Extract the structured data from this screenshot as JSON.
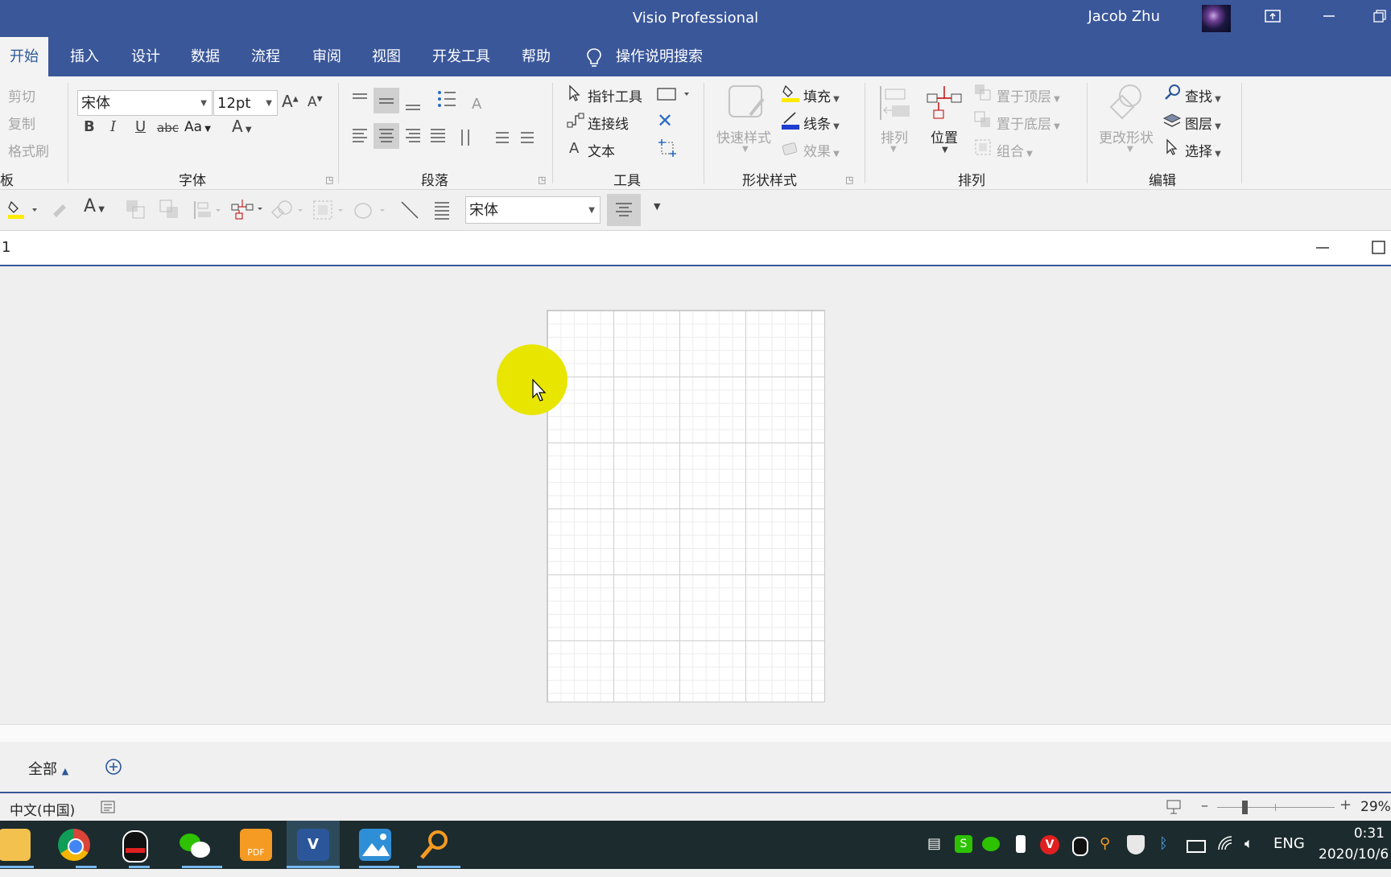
{
  "window": {
    "title": "Visio Professional",
    "user": "Jacob Zhu",
    "ribbon_display_icon": "ribbon-display-icon",
    "minimize_icon": "minimize-icon",
    "restore_icon": "restore-icon"
  },
  "tabs": [
    {
      "label": "开始",
      "active": true
    },
    {
      "label": "插入"
    },
    {
      "label": "设计"
    },
    {
      "label": "数据"
    },
    {
      "label": "流程"
    },
    {
      "label": "审阅"
    },
    {
      "label": "视图"
    },
    {
      "label": "开发工具"
    },
    {
      "label": "帮助"
    }
  ],
  "tell_me": {
    "label": "操作说明搜索",
    "icon": "lightbulb-icon"
  },
  "ribbon": {
    "clipboard": {
      "cut": "剪切",
      "copy": "复制",
      "format_painter": "格式刷",
      "group": "板"
    },
    "font": {
      "name": "宋体",
      "size": "12pt",
      "case": "Aa",
      "group": "字体"
    },
    "paragraph": {
      "group": "段落"
    },
    "tools": {
      "pointer": "指针工具",
      "connector": "连接线",
      "text": "文本",
      "group": "工具"
    },
    "shape_styles": {
      "quick_styles": "快速样式",
      "fill": "填充",
      "line": "线条",
      "effects": "效果",
      "group": "形状样式",
      "fill_color": "#ffeb00",
      "line_color": "#1f3ecf"
    },
    "arrange": {
      "align": "排列",
      "position": "位置",
      "bring_front": "置于顶层",
      "send_back": "置于底层",
      "group_btn": "组合",
      "group": "排列"
    },
    "editing": {
      "change_shape": "更改形状",
      "find": "查找",
      "layers": "图层",
      "select": "选择",
      "group": "编辑"
    }
  },
  "minibar": {
    "font": "宋体"
  },
  "document": {
    "title": "1"
  },
  "page_tabs": {
    "all": "全部"
  },
  "status": {
    "language": "中文(中国)",
    "zoom": "29%",
    "zoom_fraction": 0.23
  },
  "taskbar": {
    "apps": [
      "file-explorer-icon",
      "chrome-icon",
      "qq-icon",
      "wechat-icon",
      "pdf-icon",
      "visio-icon",
      "photos-icon",
      "search-app-icon"
    ],
    "lang": "ENG",
    "time": "0:31",
    "date": "2020/10/6"
  }
}
